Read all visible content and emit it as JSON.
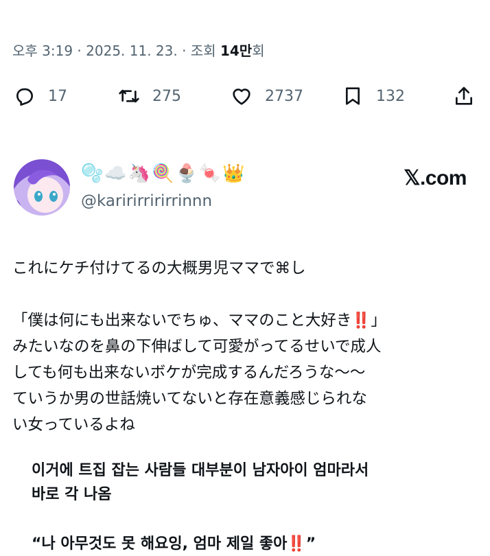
{
  "meta": {
    "prefix": "오후 3:19 · 2025. 11. 23. · 조회 ",
    "views": "14만",
    "suffix": "회"
  },
  "actions": {
    "reply_count": "17",
    "retweet_count": "275",
    "like_count": "2737",
    "bookmark_count": "132"
  },
  "icons": {
    "reply": "reply-icon",
    "retweet": "retweet-icon",
    "like": "heart-icon",
    "bookmark": "bookmark-icon",
    "share": "share-icon"
  },
  "embedded_tweet": {
    "display_name_emojis": "🫧☁️🦄🍭🍨🍬👑",
    "handle": "@karirirririrrinnn",
    "source": "𝕏.com",
    "body": "これにケチ付けてるの大概男児ママで⌘し\n\n「僕は何にも出来ないでちゅ、ママのこと大好き‼️」\nみたいなのを鼻の下伸ばして可愛がってるせいで成人\nしても何も出来ないボケが完成するんだろうな～～\nていうか男の世話焼いてないと存在意義感じられな\nい女っているよね"
  },
  "korean_caption": {
    "line1": "이거에 트집 잡는 사람들 대부분이 남자아이 엄마라서",
    "line2": "바로 각 나옴",
    "quote": "“나 아무것도 못 해요잉, 엄마 제일 좋아‼️”"
  },
  "colors": {
    "text": "#0f1419",
    "secondary": "#536471",
    "background": "#ffffff"
  }
}
